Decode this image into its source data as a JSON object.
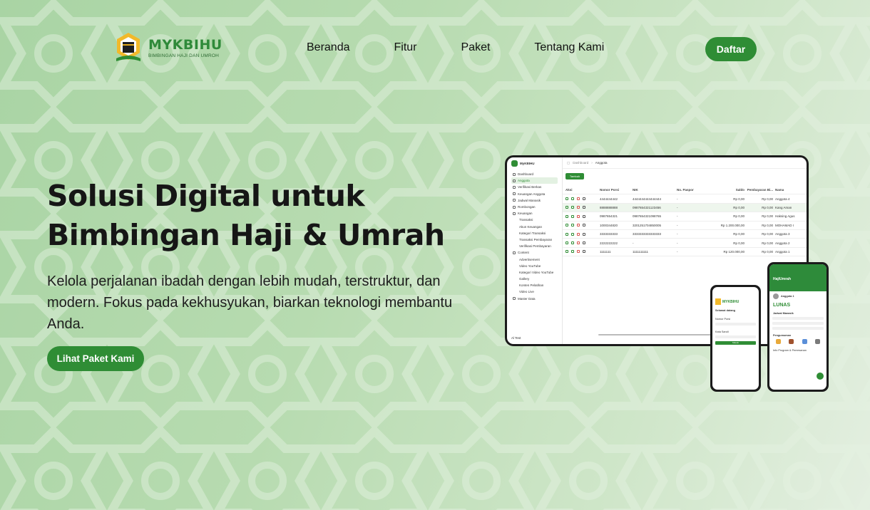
{
  "brand": {
    "name": "MYKBIHU",
    "tagline": "BIMBINGAN HAJI DAN UMROH",
    "primary_color": "#2f8d35"
  },
  "nav": {
    "links": [
      "Beranda",
      "Fitur",
      "Paket",
      "Tentang Kami"
    ],
    "cta_label": "Daftar"
  },
  "hero": {
    "title_line1": "Solusi Digital untuk",
    "title_line2": "Bimbingan Haji & Umrah",
    "description": "Kelola perjalanan ibadah dengan lebih mudah, terstruktur, dan modern. Fokus pada kekhusyukan, biarkan teknologi membantu Anda.",
    "cta_label": "Lihat Paket Kami"
  },
  "tablet_mockup": {
    "app_name": "MyKBIHU",
    "breadcrumb": [
      "Dashboard",
      "Anggota"
    ],
    "add_button": "Tambah",
    "sidebar": [
      {
        "label": "Dashboard",
        "sub": false,
        "active": false
      },
      {
        "label": "Anggota",
        "sub": false,
        "active": true
      },
      {
        "label": "Verifikasi Berkas",
        "sub": false,
        "active": false
      },
      {
        "label": "Keuangan Anggota",
        "sub": false,
        "active": false
      },
      {
        "label": "Jadwal Manasik",
        "sub": false,
        "active": false
      },
      {
        "label": "Rombongan",
        "sub": false,
        "active": false
      },
      {
        "label": "Keuangan",
        "sub": false,
        "active": false
      },
      {
        "label": "Transaksi",
        "sub": true,
        "active": false
      },
      {
        "label": "Akun Keuangan",
        "sub": true,
        "active": false
      },
      {
        "label": "Kategori Transaksi",
        "sub": true,
        "active": false
      },
      {
        "label": "Transaksi Pembayaran",
        "sub": true,
        "active": false
      },
      {
        "label": "Verifikasi Pembayaran",
        "sub": true,
        "active": false
      },
      {
        "label": "Content",
        "sub": false,
        "active": false
      },
      {
        "label": "Advertisement",
        "sub": true,
        "active": false
      },
      {
        "label": "Video YouTube",
        "sub": true,
        "active": false
      },
      {
        "label": "Kategori Video YouTube",
        "sub": true,
        "active": false
      },
      {
        "label": "Gallery",
        "sub": true,
        "active": false
      },
      {
        "label": "Konten Pelatihan",
        "sub": true,
        "active": false
      },
      {
        "label": "Video Live",
        "sub": true,
        "active": false
      },
      {
        "label": "Master Data",
        "sub": false,
        "active": false
      }
    ],
    "user": "Al Test",
    "columns": [
      "Aksi",
      "Nomor Porsi",
      "NIK",
      "No. Paspor",
      "Saldo",
      "Pembayaran Bi...",
      "Nama"
    ],
    "rows": [
      [
        "4444444442",
        "4444444444444444",
        "-",
        "Rp 0,00",
        "Rp 0,00",
        "Anggota 4"
      ],
      [
        "8888888888",
        "0987654321123456",
        "-",
        "Rp 0,00",
        "Rp 0,00",
        "Kang Aman"
      ],
      [
        "0987654321",
        "0987654321098765",
        "-",
        "Rp 0,00",
        "Rp 0,00",
        "Haksing Agus"
      ],
      [
        "1000344820",
        "3201251704850005",
        "-",
        "Rp 1.200.000,00",
        "Rp 0,00",
        "MOHAMAD I"
      ],
      [
        "3333333333",
        "3333333333333333",
        "-",
        "Rp 0,00",
        "Rp 0,00",
        "Anggota 3"
      ],
      [
        "2222222222",
        "-",
        "-",
        "Rp 0,00",
        "Rp 0,00",
        "Anggota 2"
      ],
      [
        "1111111",
        "1111111111",
        "-",
        "Rp 120.000,00",
        "Rp 0,00",
        "Anggota 1"
      ]
    ]
  },
  "phone1": {
    "brand": "MYKBIHU",
    "greeting": "Selamat datang",
    "field1": "Nomor Porsi",
    "field2": "Kata Sandi",
    "button": "Masuk"
  },
  "phone2": {
    "header_title": "HajiUmrah",
    "member": "Anggota 1",
    "status": "LUNAS",
    "section1": "Jadwal Manasik",
    "section2": "Pengumuman",
    "footer_text": "Info Program & Pemesanan"
  }
}
